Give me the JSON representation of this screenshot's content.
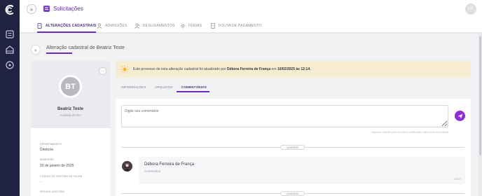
{
  "app": {
    "logo_icon": "app-logo-icon",
    "rail_icons": [
      "list-icon",
      "building-icon",
      "tag-icon"
    ]
  },
  "topbar": {
    "title": "Solicitações",
    "user_initials": "DF",
    "collapse_icon": "double-chevron-right-icon"
  },
  "tabs": [
    {
      "label": "ALTERAÇÕES CADASTRAIS",
      "icon": "edit-document-icon",
      "active": true
    },
    {
      "label": "ADMISSÕES",
      "icon": "user-icon",
      "active": false
    },
    {
      "label": "DESLIGAMENTOS",
      "icon": "user-remove-icon",
      "active": false
    },
    {
      "label": "FÉRIAS",
      "icon": "sun-icon",
      "active": false
    },
    {
      "label": "FOLHA DE PAGAMENTO",
      "icon": "payroll-icon",
      "active": false
    }
  ],
  "page": {
    "title": "Alteração cadastral de Beatriz Teste"
  },
  "profile": {
    "initials": "BT",
    "name": "Beatriz Teste",
    "role": "Analista de RH",
    "fields": [
      {
        "label": "DEPARTAMENTO",
        "value": "Diretoria"
      },
      {
        "label": "ADMISSÃO",
        "value": "20 de janeiro de 2025"
      },
      {
        "label": "CÓDIGO DO SISTEMA DE FOLHA",
        "value": "-"
      },
      {
        "label": "PESSOA GESTORA",
        "value": ""
      }
    ]
  },
  "banner": {
    "prefix": "Este processo de esta alteração cadastral foi atualizado por ",
    "author": "Débora Ferreira de França",
    "middle": " em ",
    "datetime": "10/02/2025 às 12:14.",
    "color": "#f6ecd2"
  },
  "inner_tabs": [
    {
      "label": "INFORMAÇÕES",
      "active": false
    },
    {
      "label": "ARQUIVOS",
      "active": false
    },
    {
      "label": "COMENTÁRIOS",
      "active": true
    }
  ],
  "comments": {
    "input_placeholder": "Digite seu comentário",
    "hint": "Apenas contato para enviar a notificação para uma nova linha",
    "dates": [
      "11/02/2023",
      "10/02/2023"
    ],
    "items": [
      {
        "author": "Débora Ferreira de França",
        "text": "Comentario",
        "time": "13:17"
      }
    ]
  },
  "colors": {
    "accent": "#6a2fb8",
    "send_button": "#8e2fd6",
    "rail": "#1f2341"
  }
}
